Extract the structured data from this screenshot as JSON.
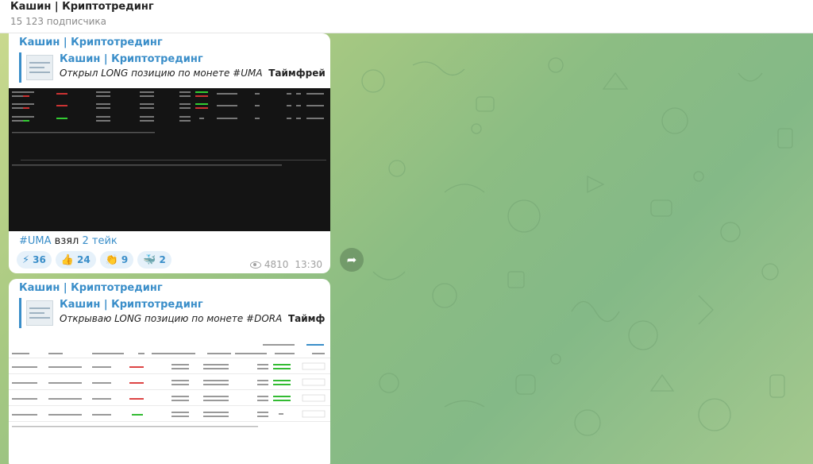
{
  "header": {
    "title": "Кашин | Криптотрединг",
    "subscribers": "15 123 подписчика"
  },
  "posts": [
    {
      "channel_name": "Кашин | Криптотрединг",
      "reply": {
        "name": "Кашин | Криптотрединг",
        "text_italic": "Открыл LONG позицию по монете #UMA",
        "text_bold": "Таймфрейм ..."
      },
      "caption_tag": "#UMA",
      "caption_text": " взял ",
      "caption_link": "2 тейк",
      "reactions": [
        {
          "emoji": "⚡",
          "count": "36"
        },
        {
          "emoji": "👍",
          "count": "24"
        },
        {
          "emoji": "👏",
          "count": "9"
        },
        {
          "emoji": "🐳",
          "count": "2"
        }
      ],
      "views": "4810",
      "time": "13:30"
    },
    {
      "channel_name": "Кашин | Криптотрединг",
      "reply": {
        "name": "Кашин | Криптотрединг",
        "text_italic": "Открываю LONG позицию по монете #DORA",
        "text_bold": "Таймфре..."
      }
    }
  ],
  "icons": {
    "forward": "forward-icon",
    "views": "eye-icon"
  },
  "colors": {
    "accent": "#3a8ec9",
    "reaction_bg": "#e6f1fa"
  }
}
